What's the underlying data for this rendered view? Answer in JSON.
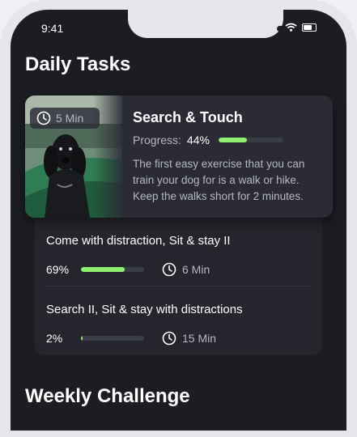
{
  "status_bar": {
    "time": "9:41"
  },
  "daily": {
    "title": "Daily Tasks",
    "featured": {
      "duration": "5 Min",
      "title": "Search & Touch",
      "progress_label": "Progress:",
      "progress_value": "44%",
      "progress": 0.44,
      "description": "The first easy exercise that you can train your dog for is a walk or hike. Keep the walks short for  2 minutes."
    },
    "tasks": [
      {
        "title": "Come with distraction, Sit & stay II",
        "progress_value": "69%",
        "progress": 0.69,
        "duration": "6 Min"
      },
      {
        "title": "Search II, Sit & stay with distractions",
        "progress_value": "2%",
        "progress": 0.02,
        "duration": "15 Min"
      }
    ]
  },
  "weekly": {
    "title": "Weekly Challenge"
  },
  "colors": {
    "accent": "#8ef06e",
    "background": "#1c1d22",
    "card": "#2a2b34"
  }
}
